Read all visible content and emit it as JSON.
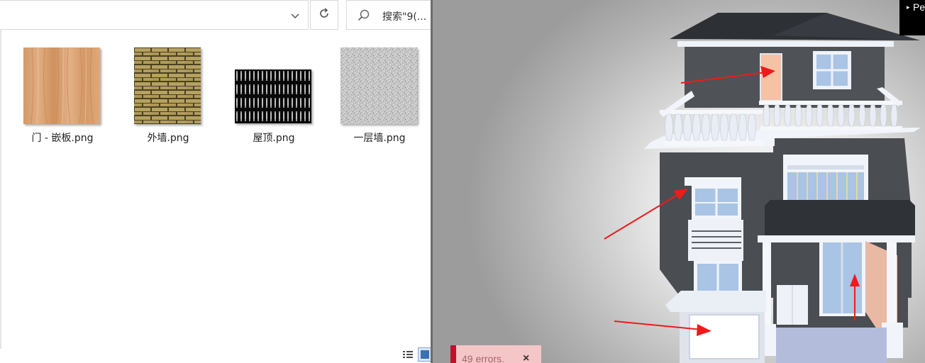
{
  "explorer": {
    "search_placeholder": "搜索\"9(...",
    "files": [
      {
        "name": "门 - 嵌板.png",
        "texture": "wood"
      },
      {
        "name": "外墙.png",
        "texture": "brick"
      },
      {
        "name": "屋顶.png",
        "texture": "roof-stripes"
      },
      {
        "name": "一层墙.png",
        "texture": "noise"
      }
    ]
  },
  "viewport": {
    "panel_toggle_label": "Pe",
    "errors_text": "49 errors.",
    "close_symbol": "×"
  },
  "colors": {
    "wall_dark": "#4f5257",
    "roof": "#2d3035",
    "trim": "#f1f4fa",
    "glass": "#a9c4e4",
    "arrow_red": "#ee1b1b",
    "error_bg": "#f5c6c8",
    "error_accent": "#c2102a"
  }
}
